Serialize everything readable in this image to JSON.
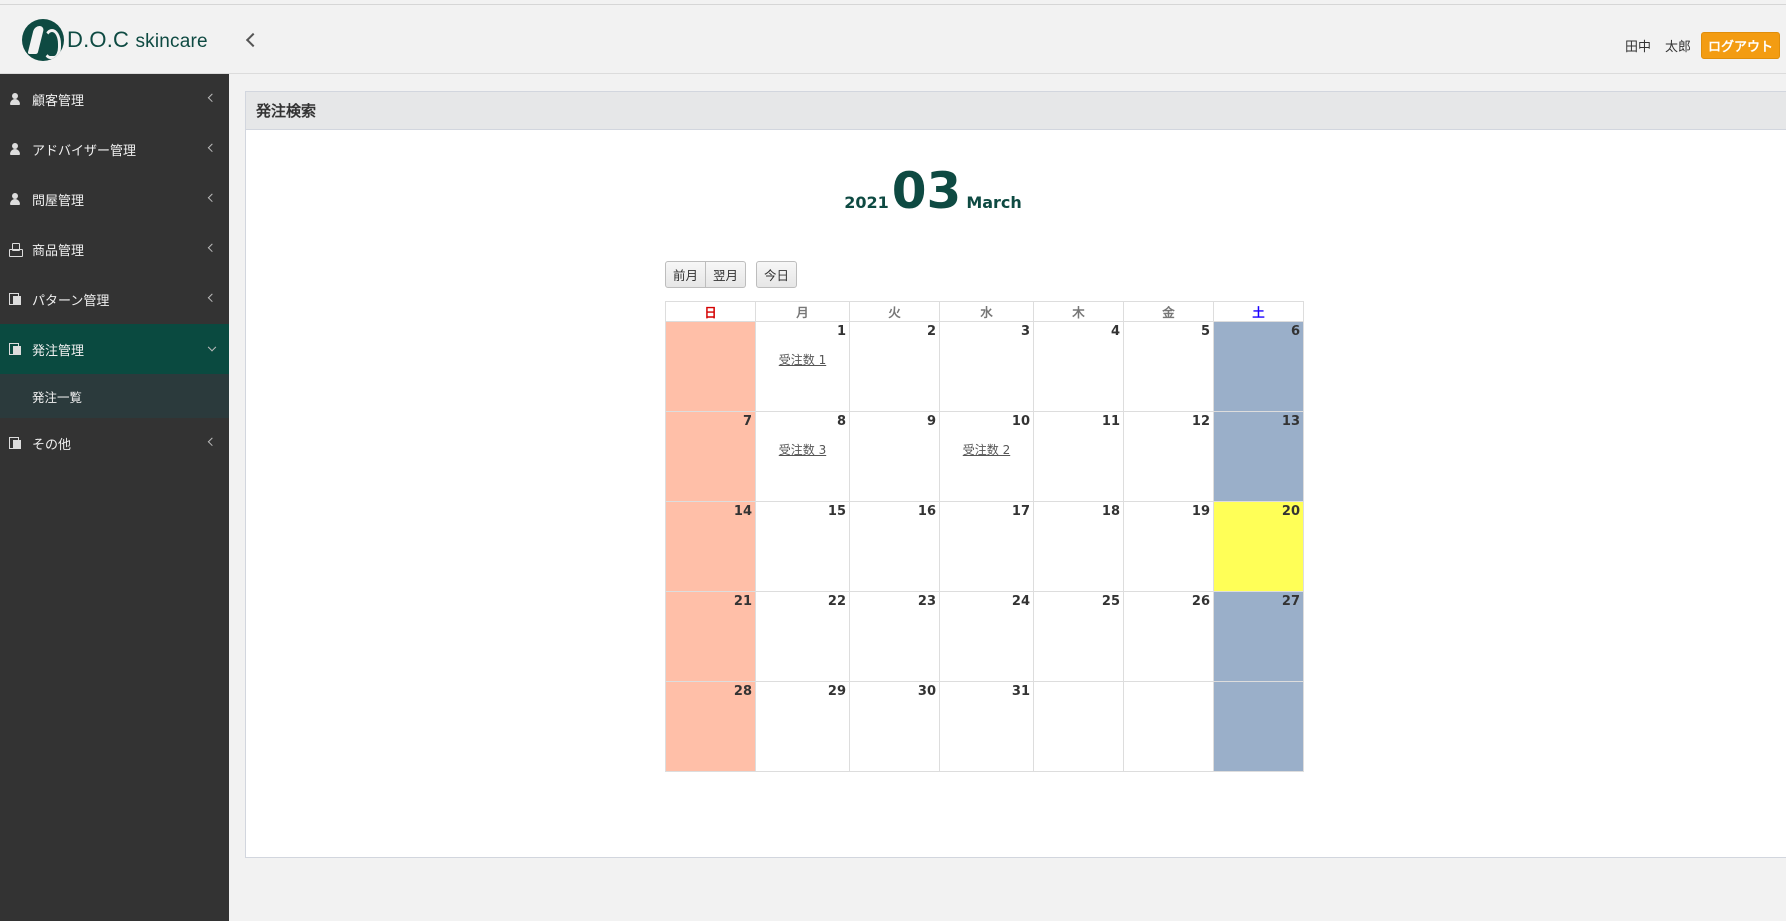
{
  "header": {
    "logo_text_main": "D.O.C",
    "logo_text_sub": "skincare",
    "user_last": "田中",
    "user_first": "太郎",
    "logout_label": "ログアウト",
    "accent_color": "#f39c12",
    "brand_color": "#0e4a42"
  },
  "sidebar": {
    "items": [
      {
        "label": "顧客管理",
        "icon": "user-icon"
      },
      {
        "label": "アドバイザー管理",
        "icon": "user-icon"
      },
      {
        "label": "問屋管理",
        "icon": "user-icon"
      },
      {
        "label": "商品管理",
        "icon": "cubes-icon"
      },
      {
        "label": "パターン管理",
        "icon": "copy-icon"
      },
      {
        "label": "発注管理",
        "icon": "copy-icon",
        "active": true
      },
      {
        "label": "その他",
        "icon": "copy-icon"
      }
    ],
    "sub_items": [
      {
        "label": "発注一覧"
      }
    ]
  },
  "panel": {
    "title": "発注検索"
  },
  "calendar": {
    "year": "2021",
    "month": "03",
    "month_name": "March",
    "buttons": {
      "prev": "前月",
      "next": "翌月",
      "today": "今日"
    },
    "weekdays": [
      "日",
      "月",
      "火",
      "水",
      "木",
      "金",
      "土"
    ],
    "weeks": [
      [
        null,
        {
          "day": "1",
          "link": "受注数 1"
        },
        {
          "day": "2"
        },
        {
          "day": "3"
        },
        {
          "day": "4"
        },
        {
          "day": "5"
        },
        {
          "day": "6"
        }
      ],
      [
        {
          "day": "7"
        },
        {
          "day": "8",
          "link": "受注数 3"
        },
        {
          "day": "9"
        },
        {
          "day": "10",
          "link": "受注数 2"
        },
        {
          "day": "11"
        },
        {
          "day": "12"
        },
        {
          "day": "13"
        }
      ],
      [
        {
          "day": "14"
        },
        {
          "day": "15"
        },
        {
          "day": "16"
        },
        {
          "day": "17"
        },
        {
          "day": "18"
        },
        {
          "day": "19"
        },
        {
          "day": "20",
          "today": true
        }
      ],
      [
        {
          "day": "21"
        },
        {
          "day": "22"
        },
        {
          "day": "23"
        },
        {
          "day": "24"
        },
        {
          "day": "25"
        },
        {
          "day": "26"
        },
        {
          "day": "27"
        }
      ],
      [
        {
          "day": "28"
        },
        {
          "day": "29"
        },
        {
          "day": "30"
        },
        {
          "day": "31"
        },
        null,
        null,
        null
      ]
    ],
    "colors": {
      "sunday": "#ffbfa8",
      "saturday": "#9aafc9",
      "today": "#ffff57"
    }
  }
}
